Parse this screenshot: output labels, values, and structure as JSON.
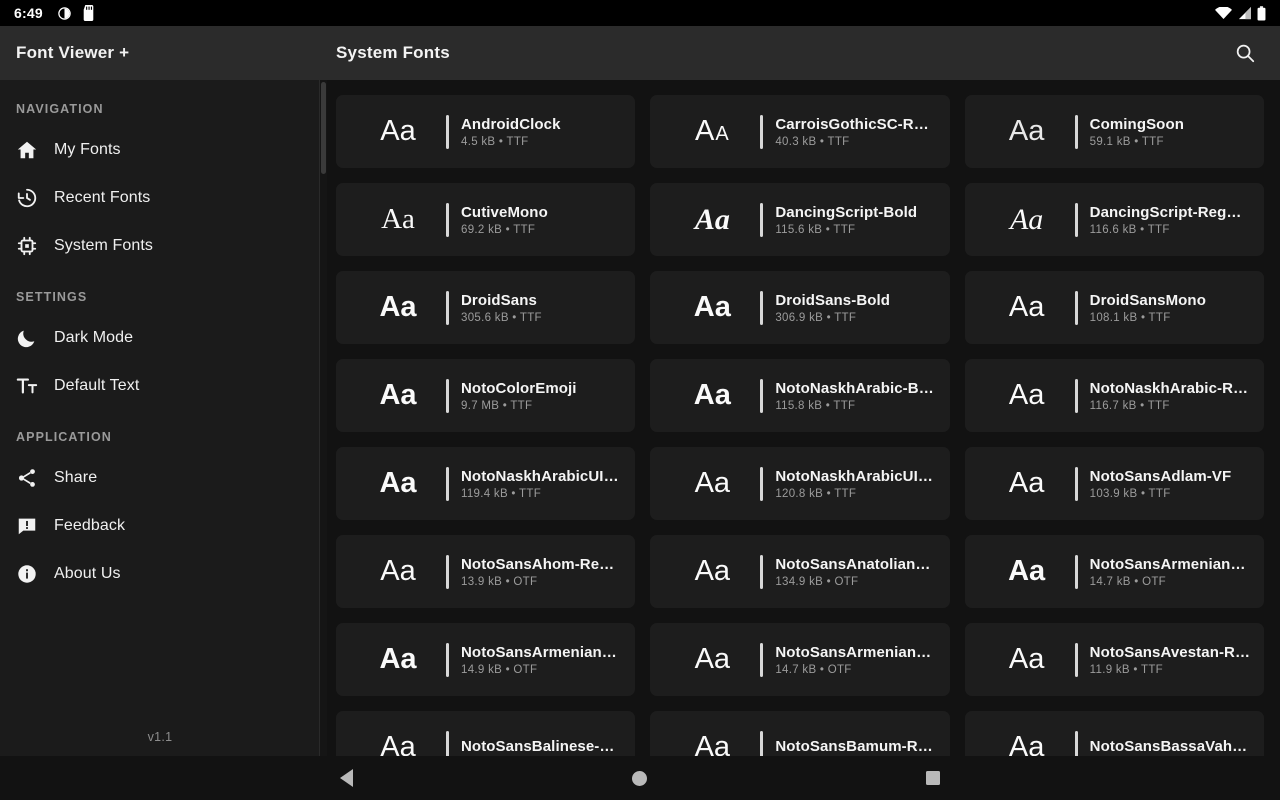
{
  "status_bar": {
    "time": "6:49",
    "icons_left": [
      "brightness-icon",
      "sd-card-icon"
    ],
    "icons_right": [
      "wifi-icon",
      "signal-icon",
      "battery-icon"
    ]
  },
  "sidebar": {
    "brand_title": "Font Viewer +",
    "version": "v1.1",
    "sections": [
      {
        "title": "NAVIGATION",
        "items": [
          {
            "label": "My Fonts",
            "icon": "home-icon"
          },
          {
            "label": "Recent Fonts",
            "icon": "history-icon"
          },
          {
            "label": "System Fonts",
            "icon": "chip-icon"
          }
        ]
      },
      {
        "title": "SETTINGS",
        "items": [
          {
            "label": "Dark Mode",
            "icon": "moon-icon"
          },
          {
            "label": "Default Text",
            "icon": "text-format-icon"
          }
        ]
      },
      {
        "title": "APPLICATION",
        "items": [
          {
            "label": "Share",
            "icon": "share-icon"
          },
          {
            "label": "Feedback",
            "icon": "feedback-icon"
          },
          {
            "label": "About Us",
            "icon": "info-icon"
          }
        ]
      }
    ]
  },
  "topbar": {
    "title": "System Fonts",
    "search_icon": "search-icon"
  },
  "font_grid": {
    "preview_text": "Aa",
    "items": [
      {
        "name": "AndroidClock",
        "size": "4.5 kB",
        "format": "TTF",
        "style": ""
      },
      {
        "name": "CarroisGothicSC-Regul…",
        "size": "40.3 kB",
        "format": "TTF",
        "style": "p-caps"
      },
      {
        "name": "ComingSoon",
        "size": "59.1 kB",
        "format": "TTF",
        "style": "p-light"
      },
      {
        "name": "CutiveMono",
        "size": "69.2 kB",
        "format": "TTF",
        "style": "p-serif"
      },
      {
        "name": "DancingScript-Bold",
        "size": "115.6 kB",
        "format": "TTF",
        "style": "p-script p-bold"
      },
      {
        "name": "DancingScript-Regular",
        "size": "116.6 kB",
        "format": "TTF",
        "style": "p-script"
      },
      {
        "name": "DroidSans",
        "size": "305.6 kB",
        "format": "TTF",
        "style": "p-bold"
      },
      {
        "name": "DroidSans-Bold",
        "size": "306.9 kB",
        "format": "TTF",
        "style": "p-bold"
      },
      {
        "name": "DroidSansMono",
        "size": "108.1 kB",
        "format": "TTF",
        "style": ""
      },
      {
        "name": "NotoColorEmoji",
        "size": "9.7 MB",
        "format": "TTF",
        "style": "p-bold"
      },
      {
        "name": "NotoNaskhArabic-Bold",
        "size": "115.8 kB",
        "format": "TTF",
        "style": "p-bold"
      },
      {
        "name": "NotoNaskhArabic-Reg…",
        "size": "116.7 kB",
        "format": "TTF",
        "style": ""
      },
      {
        "name": "NotoNaskhArabicUI-B…",
        "size": "119.4 kB",
        "format": "TTF",
        "style": "p-bold"
      },
      {
        "name": "NotoNaskhArabicUI-R…",
        "size": "120.8 kB",
        "format": "TTF",
        "style": ""
      },
      {
        "name": "NotoSansAdlam-VF",
        "size": "103.9 kB",
        "format": "TTF",
        "style": ""
      },
      {
        "name": "NotoSansAhom-Regul…",
        "size": "13.9 kB",
        "format": "OTF",
        "style": ""
      },
      {
        "name": "NotoSansAnatolianHi…",
        "size": "134.9 kB",
        "format": "OTF",
        "style": ""
      },
      {
        "name": "NotoSansArmenian-B…",
        "size": "14.7 kB",
        "format": "OTF",
        "style": "p-bold"
      },
      {
        "name": "NotoSansArmenian-M…",
        "size": "14.9 kB",
        "format": "OTF",
        "style": "p-bold"
      },
      {
        "name": "NotoSansArmenian-R…",
        "size": "14.7 kB",
        "format": "OTF",
        "style": ""
      },
      {
        "name": "NotoSansAvestan-Re…",
        "size": "11.9 kB",
        "format": "TTF",
        "style": ""
      },
      {
        "name": "NotoSansBalinese-Re…",
        "size": "",
        "format": "",
        "style": ""
      },
      {
        "name": "NotoSansBamum-Reg…",
        "size": "",
        "format": "",
        "style": ""
      },
      {
        "name": "NotoSansBassaVah-R…",
        "size": "",
        "format": "",
        "style": ""
      }
    ]
  },
  "nav_bar": {
    "back": "back-button",
    "home": "home-button",
    "recents": "recents-button"
  },
  "colors": {
    "app_bg": "#121212",
    "sidebar_bg": "#1b1b1b",
    "bar_bg": "#2b2b2b",
    "card_bg": "#1d1d1d",
    "text_primary": "#f5f5f5",
    "text_secondary": "#9c9c9c"
  }
}
